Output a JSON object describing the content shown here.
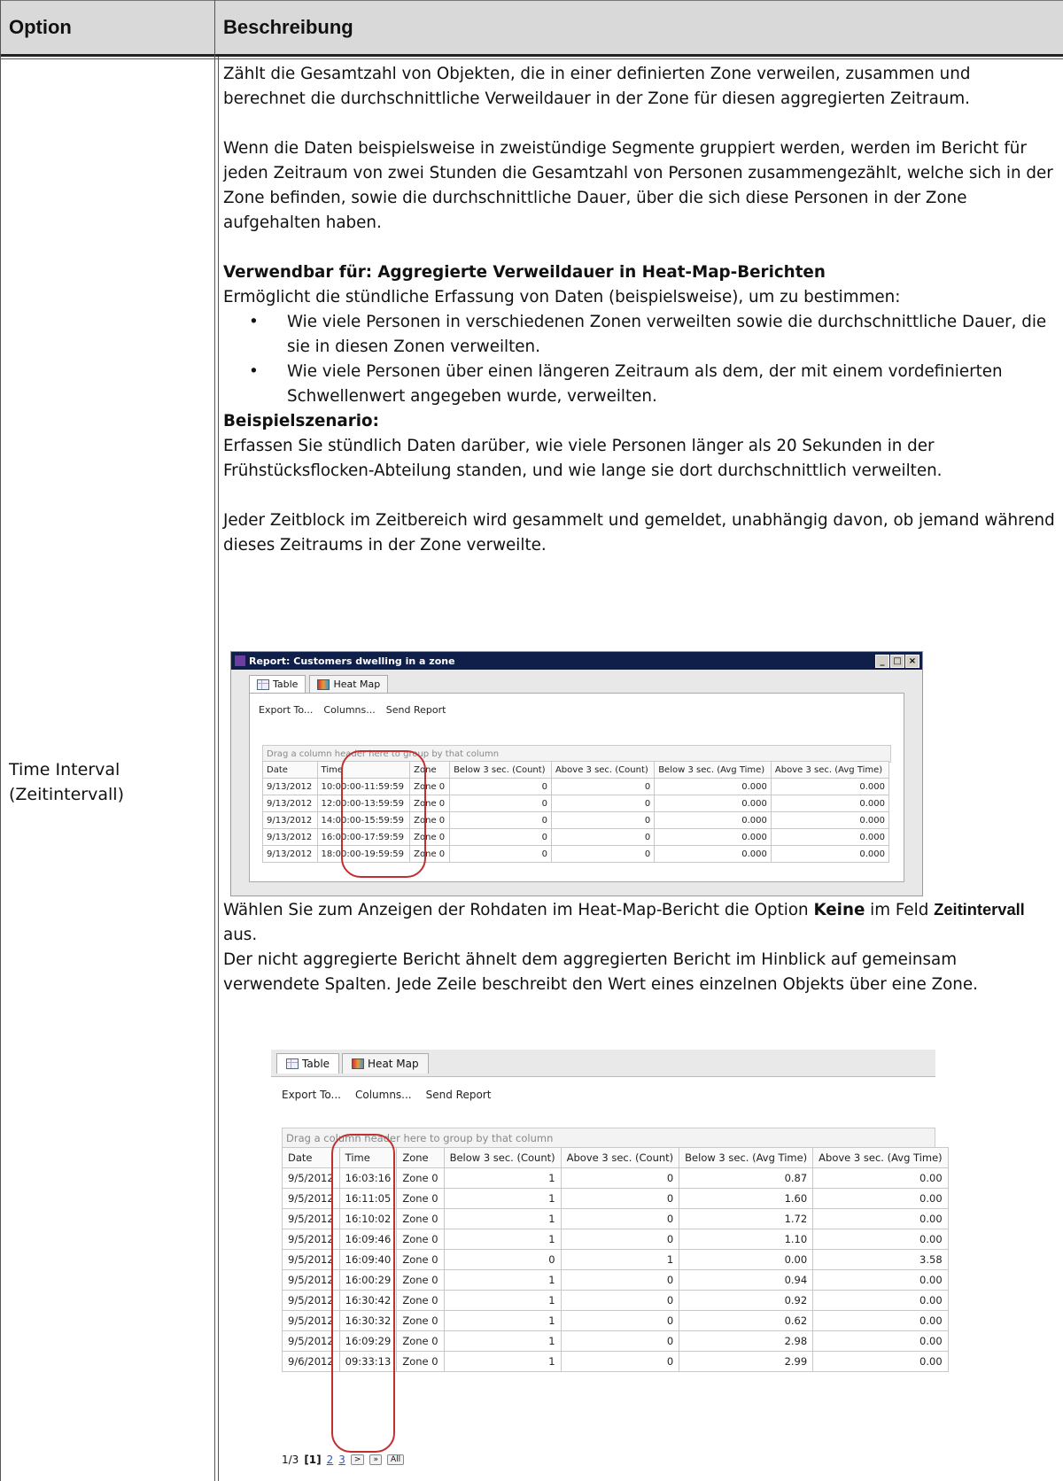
{
  "header": {
    "col1": "Option",
    "col2": "Beschreibung"
  },
  "option_label": [
    "Time Interval",
    "(Zeitintervall)"
  ],
  "paragraphs": {
    "p1": "Zählt die Gesamtzahl von Objekten, die in einer definierten Zone verweilen, zusammen und berechnet die durchschnittliche Verweildauer in der Zone für diesen aggregierten Zeitraum.",
    "p2": "Wenn die Daten beispielsweise in zweistündige Segmente gruppiert werden, werden im Bericht für jeden Zeitraum von zwei Stunden die Gesamtzahl von Personen zusammengezählt, welche sich in der Zone befinden, sowie die durchschnittliche Dauer, über die sich diese Personen in der Zone aufgehalten haben.",
    "usable_heading": "Verwendbar für: Aggregierte Verweildauer in Heat-Map-Berichten",
    "usable_intro": "Ermöglicht die stündliche Erfassung von Daten (beispielsweise), um zu bestimmen:",
    "bullets": [
      "Wie viele Personen in verschiedenen Zonen verweilten sowie die durchschnittliche Dauer, die sie in diesen Zonen verweilten.",
      "Wie viele Personen über einen längeren Zeitraum als dem, der mit einem vordefinierten Schwellenwert angegeben wurde, verweilten."
    ],
    "bullet_char": "•",
    "example_heading": "Beispielszenario:",
    "example_text": "Erfassen Sie stündlich Daten darüber, wie viele Personen länger als 20 Sekunden in der Frühstücksflocken-Abteilung standen, und wie lange sie dort durchschnittlich verweilten.",
    "p3": "Jeder Zeitblock im Zeitbereich wird gesammelt und gemeldet, unabhängig davon, ob jemand während dieses Zeitraums in der Zone verweilte.",
    "p4_pre": "Wählen Sie zum Anzeigen der Rohdaten im Heat-Map-Bericht die Option ",
    "p4_bold1": "Keine",
    "p4_mid": " im Feld ",
    "p4_bold2": "Zeitintervall",
    "p4_post": " aus.",
    "p5": "Der nicht aggregierte Bericht ähnelt dem aggregierten Bericht im Hinblick auf gemeinsam verwendete Spalten. Jede Zeile beschreibt den Wert eines einzelnen Objekts über eine Zone."
  },
  "screenshot1": {
    "window_title": "Report: Customers dwelling in a zone",
    "window_buttons": [
      "_",
      "□",
      "×"
    ],
    "tabs": [
      "Table",
      "Heat Map"
    ],
    "toolbar": [
      "Export To...",
      "Columns...",
      "Send Report"
    ],
    "group_hint": "Drag a column header here to group by that column",
    "columns": [
      "Date",
      "Time",
      "Zone",
      "Below 3 sec. (Count)",
      "Above 3 sec. (Count)",
      "Below 3 sec. (Avg Time)",
      "Above 3 sec. (Avg Time)"
    ],
    "rows": [
      [
        "9/13/2012",
        "10:00:00-11:59:59",
        "Zone 0",
        "0",
        "0",
        "0.000",
        "0.000"
      ],
      [
        "9/13/2012",
        "12:00:00-13:59:59",
        "Zone 0",
        "0",
        "0",
        "0.000",
        "0.000"
      ],
      [
        "9/13/2012",
        "14:00:00-15:59:59",
        "Zone 0",
        "0",
        "0",
        "0.000",
        "0.000"
      ],
      [
        "9/13/2012",
        "16:00:00-17:59:59",
        "Zone 0",
        "0",
        "0",
        "0.000",
        "0.000"
      ],
      [
        "9/13/2012",
        "18:00:00-19:59:59",
        "Zone 0",
        "0",
        "0",
        "0.000",
        "0.000"
      ]
    ],
    "highlight_color": "#c03030"
  },
  "screenshot2": {
    "tabs": [
      "Table",
      "Heat Map"
    ],
    "toolbar": [
      "Export To...",
      "Columns...",
      "Send Report"
    ],
    "group_hint": "Drag a column header here to group by that column",
    "columns": [
      "Date",
      "Time",
      "Zone",
      "Below 3 sec. (Count)",
      "Above 3 sec. (Count)",
      "Below 3 sec. (Avg Time)",
      "Above 3 sec. (Avg Time)"
    ],
    "rows": [
      [
        "9/5/2012",
        "16:03:16",
        "Zone 0",
        "1",
        "0",
        "0.87",
        "0.00"
      ],
      [
        "9/5/2012",
        "16:11:05",
        "Zone 0",
        "1",
        "0",
        "1.60",
        "0.00"
      ],
      [
        "9/5/2012",
        "16:10:02",
        "Zone 0",
        "1",
        "0",
        "1.72",
        "0.00"
      ],
      [
        "9/5/2012",
        "16:09:46",
        "Zone 0",
        "1",
        "0",
        "1.10",
        "0.00"
      ],
      [
        "9/5/2012",
        "16:09:40",
        "Zone 0",
        "0",
        "1",
        "0.00",
        "3.58"
      ],
      [
        "9/5/2012",
        "16:00:29",
        "Zone 0",
        "1",
        "0",
        "0.94",
        "0.00"
      ],
      [
        "9/5/2012",
        "16:30:42",
        "Zone 0",
        "1",
        "0",
        "0.92",
        "0.00"
      ],
      [
        "9/5/2012",
        "16:30:32",
        "Zone 0",
        "1",
        "0",
        "0.62",
        "0.00"
      ],
      [
        "9/5/2012",
        "16:09:29",
        "Zone 0",
        "1",
        "0",
        "2.98",
        "0.00"
      ],
      [
        "9/6/2012",
        "09:33:13",
        "Zone 0",
        "1",
        "0",
        "2.99",
        "0.00"
      ]
    ],
    "pager": {
      "info": "1/3",
      "current": "[1]",
      "pages": [
        "2",
        "3"
      ],
      "buttons": [
        ">",
        "»",
        "All"
      ]
    },
    "highlight_color": "#c03030"
  }
}
